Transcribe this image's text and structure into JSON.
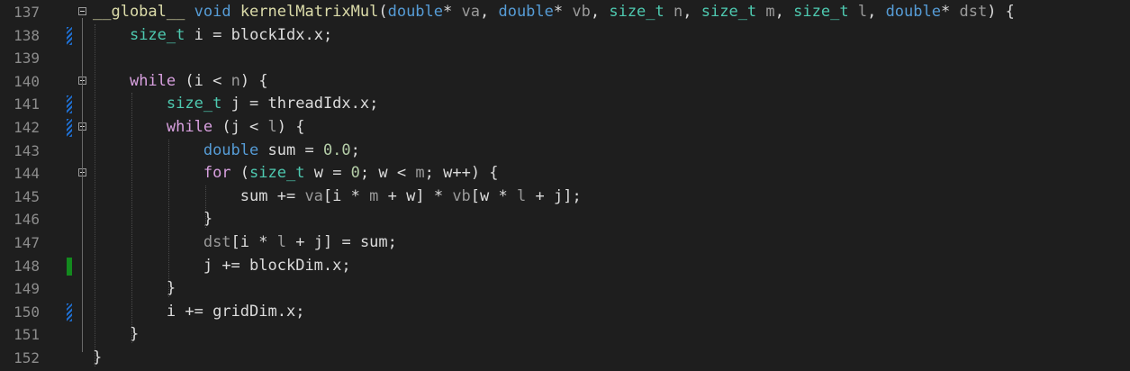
{
  "editor": {
    "lines": [
      {
        "number": "137",
        "change": "none",
        "fold": "open",
        "tokens": [
          {
            "t": "__global__",
            "c": "fn"
          },
          {
            "t": " ",
            "c": "punc"
          },
          {
            "t": "void",
            "c": "kw"
          },
          {
            "t": " ",
            "c": "punc"
          },
          {
            "t": "kernelMatrixMul",
            "c": "fn"
          },
          {
            "t": "(",
            "c": "punc"
          },
          {
            "t": "double",
            "c": "kw"
          },
          {
            "t": "* ",
            "c": "punc"
          },
          {
            "t": "va",
            "c": "par"
          },
          {
            "t": ", ",
            "c": "punc"
          },
          {
            "t": "double",
            "c": "kw"
          },
          {
            "t": "* ",
            "c": "punc"
          },
          {
            "t": "vb",
            "c": "par"
          },
          {
            "t": ", ",
            "c": "punc"
          },
          {
            "t": "size_t",
            "c": "ty"
          },
          {
            "t": " ",
            "c": "punc"
          },
          {
            "t": "n",
            "c": "par"
          },
          {
            "t": ", ",
            "c": "punc"
          },
          {
            "t": "size_t",
            "c": "ty"
          },
          {
            "t": " ",
            "c": "punc"
          },
          {
            "t": "m",
            "c": "par"
          },
          {
            "t": ", ",
            "c": "punc"
          },
          {
            "t": "size_t",
            "c": "ty"
          },
          {
            "t": " ",
            "c": "punc"
          },
          {
            "t": "l",
            "c": "par"
          },
          {
            "t": ", ",
            "c": "punc"
          },
          {
            "t": "double",
            "c": "kw"
          },
          {
            "t": "* ",
            "c": "punc"
          },
          {
            "t": "dst",
            "c": "par"
          },
          {
            "t": ") {",
            "c": "punc"
          }
        ]
      },
      {
        "number": "138",
        "change": "modified",
        "fold": "none",
        "tokens": [
          {
            "t": "    ",
            "c": "punc"
          },
          {
            "t": "size_t",
            "c": "ty"
          },
          {
            "t": " ",
            "c": "punc"
          },
          {
            "t": "i",
            "c": "id"
          },
          {
            "t": " = ",
            "c": "punc"
          },
          {
            "t": "blockIdx",
            "c": "id"
          },
          {
            "t": ".",
            "c": "punc"
          },
          {
            "t": "x",
            "c": "id"
          },
          {
            "t": ";",
            "c": "punc"
          }
        ]
      },
      {
        "number": "139",
        "change": "none",
        "fold": "none",
        "tokens": []
      },
      {
        "number": "140",
        "change": "none",
        "fold": "open",
        "tokens": [
          {
            "t": "    ",
            "c": "punc"
          },
          {
            "t": "while",
            "c": "ctl"
          },
          {
            "t": " (",
            "c": "punc"
          },
          {
            "t": "i",
            "c": "id"
          },
          {
            "t": " < ",
            "c": "punc"
          },
          {
            "t": "n",
            "c": "par"
          },
          {
            "t": ") {",
            "c": "punc"
          }
        ]
      },
      {
        "number": "141",
        "change": "modified",
        "fold": "none",
        "tokens": [
          {
            "t": "        ",
            "c": "punc"
          },
          {
            "t": "size_t",
            "c": "ty"
          },
          {
            "t": " ",
            "c": "punc"
          },
          {
            "t": "j",
            "c": "id"
          },
          {
            "t": " = ",
            "c": "punc"
          },
          {
            "t": "threadIdx",
            "c": "id"
          },
          {
            "t": ".",
            "c": "punc"
          },
          {
            "t": "x",
            "c": "id"
          },
          {
            "t": ";",
            "c": "punc"
          }
        ]
      },
      {
        "number": "142",
        "change": "modified",
        "fold": "open",
        "tokens": [
          {
            "t": "        ",
            "c": "punc"
          },
          {
            "t": "while",
            "c": "ctl"
          },
          {
            "t": " (",
            "c": "punc"
          },
          {
            "t": "j",
            "c": "id"
          },
          {
            "t": " < ",
            "c": "punc"
          },
          {
            "t": "l",
            "c": "par"
          },
          {
            "t": ") {",
            "c": "punc"
          }
        ]
      },
      {
        "number": "143",
        "change": "none",
        "fold": "none",
        "tokens": [
          {
            "t": "            ",
            "c": "punc"
          },
          {
            "t": "double",
            "c": "kw"
          },
          {
            "t": " ",
            "c": "punc"
          },
          {
            "t": "sum",
            "c": "id"
          },
          {
            "t": " = ",
            "c": "punc"
          },
          {
            "t": "0.0",
            "c": "num"
          },
          {
            "t": ";",
            "c": "punc"
          }
        ]
      },
      {
        "number": "144",
        "change": "none",
        "fold": "open",
        "tokens": [
          {
            "t": "            ",
            "c": "punc"
          },
          {
            "t": "for",
            "c": "ctl"
          },
          {
            "t": " (",
            "c": "punc"
          },
          {
            "t": "size_t",
            "c": "ty"
          },
          {
            "t": " ",
            "c": "punc"
          },
          {
            "t": "w",
            "c": "id"
          },
          {
            "t": " = ",
            "c": "punc"
          },
          {
            "t": "0",
            "c": "num"
          },
          {
            "t": "; ",
            "c": "punc"
          },
          {
            "t": "w",
            "c": "id"
          },
          {
            "t": " < ",
            "c": "punc"
          },
          {
            "t": "m",
            "c": "par"
          },
          {
            "t": "; ",
            "c": "punc"
          },
          {
            "t": "w",
            "c": "id"
          },
          {
            "t": "++) {",
            "c": "punc"
          }
        ]
      },
      {
        "number": "145",
        "change": "none",
        "fold": "none",
        "tokens": [
          {
            "t": "                ",
            "c": "punc"
          },
          {
            "t": "sum",
            "c": "id"
          },
          {
            "t": " += ",
            "c": "punc"
          },
          {
            "t": "va",
            "c": "par"
          },
          {
            "t": "[",
            "c": "punc"
          },
          {
            "t": "i",
            "c": "id"
          },
          {
            "t": " * ",
            "c": "punc"
          },
          {
            "t": "m",
            "c": "par"
          },
          {
            "t": " + ",
            "c": "punc"
          },
          {
            "t": "w",
            "c": "id"
          },
          {
            "t": "] * ",
            "c": "punc"
          },
          {
            "t": "vb",
            "c": "par"
          },
          {
            "t": "[",
            "c": "punc"
          },
          {
            "t": "w",
            "c": "id"
          },
          {
            "t": " * ",
            "c": "punc"
          },
          {
            "t": "l",
            "c": "par"
          },
          {
            "t": " + ",
            "c": "punc"
          },
          {
            "t": "j",
            "c": "id"
          },
          {
            "t": "];",
            "c": "punc"
          }
        ]
      },
      {
        "number": "146",
        "change": "none",
        "fold": "none",
        "tokens": [
          {
            "t": "            ",
            "c": "punc"
          },
          {
            "t": "}",
            "c": "punc"
          }
        ]
      },
      {
        "number": "147",
        "change": "none",
        "fold": "none",
        "tokens": [
          {
            "t": "            ",
            "c": "punc"
          },
          {
            "t": "dst",
            "c": "par"
          },
          {
            "t": "[",
            "c": "punc"
          },
          {
            "t": "i",
            "c": "id"
          },
          {
            "t": " * ",
            "c": "punc"
          },
          {
            "t": "l",
            "c": "par"
          },
          {
            "t": " + ",
            "c": "punc"
          },
          {
            "t": "j",
            "c": "id"
          },
          {
            "t": "] = ",
            "c": "punc"
          },
          {
            "t": "sum",
            "c": "id"
          },
          {
            "t": ";",
            "c": "punc"
          }
        ]
      },
      {
        "number": "148",
        "change": "added",
        "fold": "none",
        "tokens": [
          {
            "t": "            ",
            "c": "punc"
          },
          {
            "t": "j",
            "c": "id"
          },
          {
            "t": " += ",
            "c": "punc"
          },
          {
            "t": "blockDim",
            "c": "id"
          },
          {
            "t": ".",
            "c": "punc"
          },
          {
            "t": "x",
            "c": "id"
          },
          {
            "t": ";",
            "c": "punc"
          }
        ]
      },
      {
        "number": "149",
        "change": "none",
        "fold": "none",
        "tokens": [
          {
            "t": "        ",
            "c": "punc"
          },
          {
            "t": "}",
            "c": "punc"
          }
        ]
      },
      {
        "number": "150",
        "change": "modified",
        "fold": "none",
        "tokens": [
          {
            "t": "        ",
            "c": "punc"
          },
          {
            "t": "i",
            "c": "id"
          },
          {
            "t": " += ",
            "c": "punc"
          },
          {
            "t": "gridDim",
            "c": "id"
          },
          {
            "t": ".",
            "c": "punc"
          },
          {
            "t": "x",
            "c": "id"
          },
          {
            "t": ";",
            "c": "punc"
          }
        ]
      },
      {
        "number": "151",
        "change": "none",
        "fold": "none",
        "tokens": [
          {
            "t": "    ",
            "c": "punc"
          },
          {
            "t": "}",
            "c": "punc"
          }
        ]
      },
      {
        "number": "152",
        "change": "none",
        "fold": "none",
        "tokens": [
          {
            "t": "}",
            "c": "punc"
          }
        ]
      }
    ]
  }
}
